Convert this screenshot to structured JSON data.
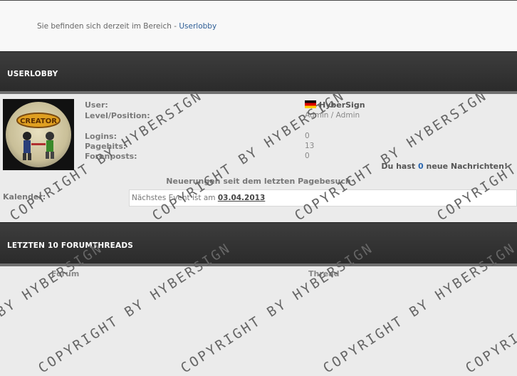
{
  "breadcrumb": {
    "prefix": "Sie befinden sich derzeit im Bereich - ",
    "link": "Userlobby"
  },
  "userlobby": {
    "title": "USERLOBBY",
    "avatar_text": "CREATOR",
    "labels": {
      "user": "User:",
      "level": "Level/Position:",
      "logins": "Logins:",
      "pagehits": "Pagehits:",
      "forenposts": "Forenposts:"
    },
    "values": {
      "user": "HyberSign",
      "level": "Admin / Admin",
      "logins": "0",
      "pagehits": "13",
      "forenposts": "0"
    },
    "messages": {
      "prefix": "Du hast ",
      "count": "0",
      "suffix": " neue Nachrichten!"
    },
    "news_heading": "Neuerungen seit dem letzten Pagebesuch",
    "kalender_label": "Kalender:",
    "kalender_text": "Nächstes Event ist am ",
    "kalender_date": "03.04.2013"
  },
  "forumthreads": {
    "title": "LETZTEN 10 FORUMTHREADS",
    "columns": [
      "Forum",
      "Thread"
    ]
  },
  "watermark": "COPYRIGHT BY HYBERSIGN",
  "colors": {
    "link": "#2e5e96",
    "band": "#333333",
    "accent_blue": "#2a67b1"
  },
  "icons": {
    "flag": "germany-flag-icon"
  }
}
